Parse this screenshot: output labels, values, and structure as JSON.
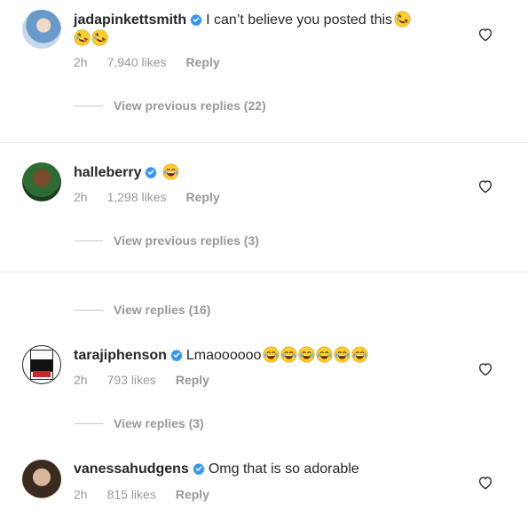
{
  "comments": [
    {
      "username": "jadapinkettsmith",
      "text": "I can’t believe you posted this",
      "emoji_line1": [
        "rofl"
      ],
      "emoji_line2": [
        "rofl",
        "rofl"
      ],
      "time": "2h",
      "likes": "7,940 likes",
      "reply": "Reply",
      "view_replies": "View previous replies (22)"
    },
    {
      "username": "halleberry",
      "text": "",
      "emoji_line1": [
        "joy"
      ],
      "time": "2h",
      "likes": "1,298 likes",
      "reply": "Reply",
      "view_replies": "View previous replies (3)",
      "view_more": "View replies (16)"
    },
    {
      "username": "tarajiphenson",
      "text": "Lmaoooooo",
      "emoji_line1": [
        "joy",
        "joy",
        "joy",
        "joy",
        "joy",
        "joy"
      ],
      "time": "2h",
      "likes": "793 likes",
      "reply": "Reply",
      "view_replies": "View replies (3)"
    },
    {
      "username": "vanessahudgens",
      "text": "Omg that is so adorable",
      "time": "2h",
      "likes": "815 likes",
      "reply": "Reply"
    }
  ],
  "colors": {
    "text": "#262626",
    "muted": "#999999",
    "verified": "#3897f0",
    "emoji": "#ffcc33"
  },
  "icons": [
    "verified-badge-icon",
    "heart-outline-icon",
    "rofl-emoji-icon",
    "joy-emoji-icon"
  ]
}
